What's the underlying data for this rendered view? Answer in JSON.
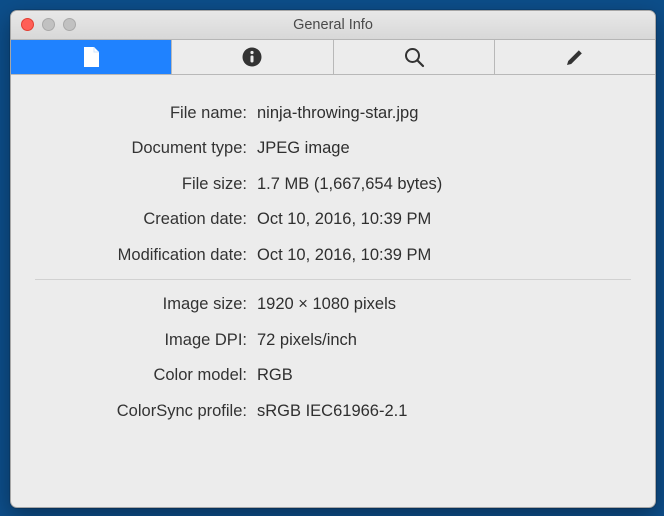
{
  "window": {
    "title": "General Info"
  },
  "tabs": [
    {
      "name": "general",
      "icon": "document-icon"
    },
    {
      "name": "info",
      "icon": "info-icon"
    },
    {
      "name": "search",
      "icon": "search-icon"
    },
    {
      "name": "edit",
      "icon": "pencil-icon"
    }
  ],
  "fields": {
    "file_name": {
      "label": "File name:",
      "value": "ninja-throwing-star.jpg"
    },
    "document_type": {
      "label": "Document type:",
      "value": "JPEG image"
    },
    "file_size": {
      "label": "File size:",
      "value": "1.7 MB (1,667,654 bytes)"
    },
    "creation_date": {
      "label": "Creation date:",
      "value": "Oct 10, 2016, 10:39 PM"
    },
    "mod_date": {
      "label": "Modification date:",
      "value": "Oct 10, 2016, 10:39 PM"
    },
    "image_size": {
      "label": "Image size:",
      "value": "1920 × 1080 pixels"
    },
    "image_dpi": {
      "label": "Image DPI:",
      "value": "72 pixels/inch"
    },
    "color_model": {
      "label": "Color model:",
      "value": "RGB"
    },
    "colorsync": {
      "label": "ColorSync profile:",
      "value": "sRGB IEC61966-2.1"
    }
  }
}
